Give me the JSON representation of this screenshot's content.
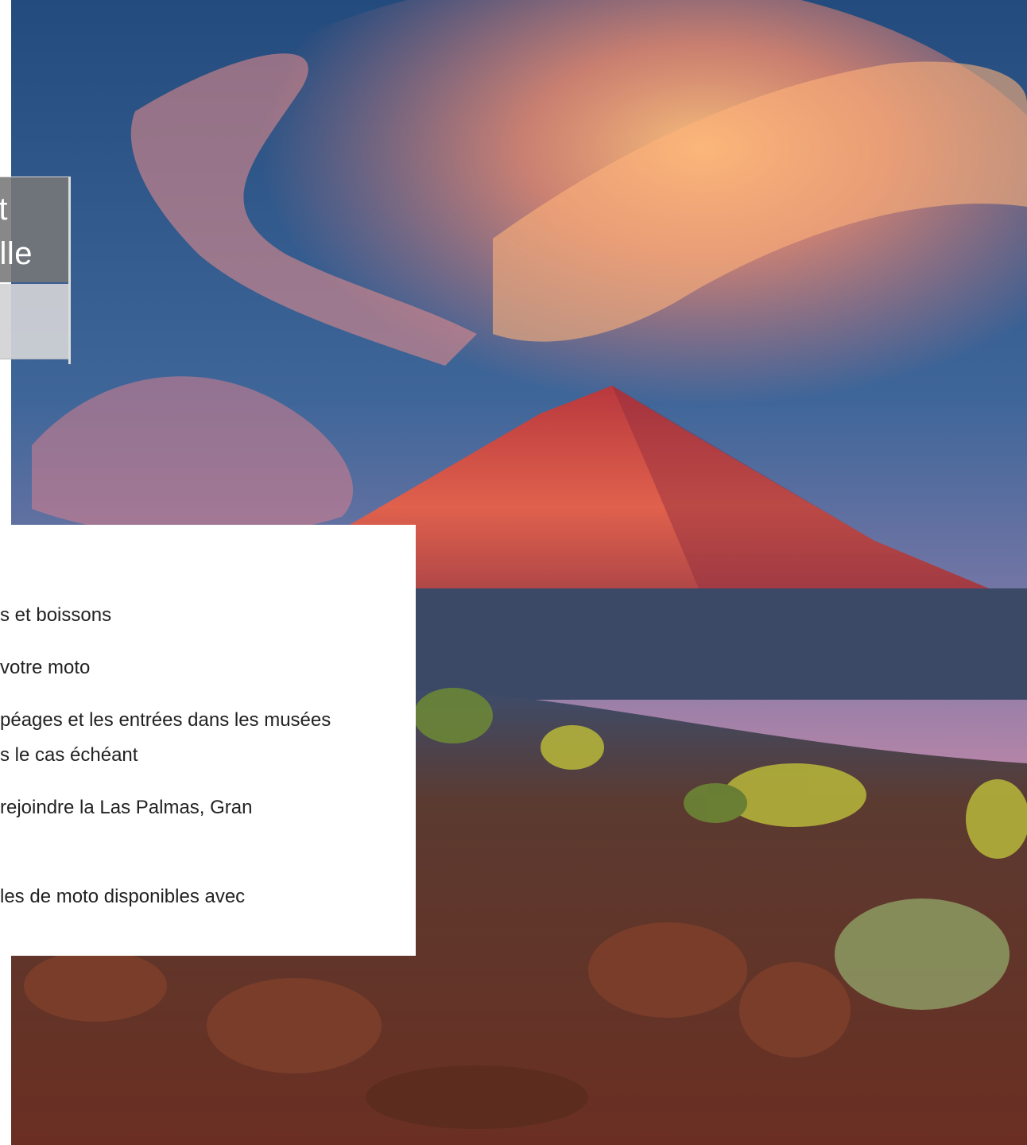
{
  "hero": {
    "icon": "volcano-landscape-photo",
    "colors": {
      "sky_top": "#2b5488",
      "sky_mid": "#4a6fa3",
      "cloud_glow": "#ff9a6a",
      "mountain": "#c2423e",
      "ground": "#5a2a1e"
    }
  },
  "side_tab": {
    "line1": "t",
    "line2": "lle"
  },
  "inclusions": [
    "s et boissons",
    "votre moto",
    "péages et les entrées dans les musées",
    "s le cas échéant",
    "rejoindre la Las Palmas, Gran",
    "les de moto disponibles avec"
  ]
}
